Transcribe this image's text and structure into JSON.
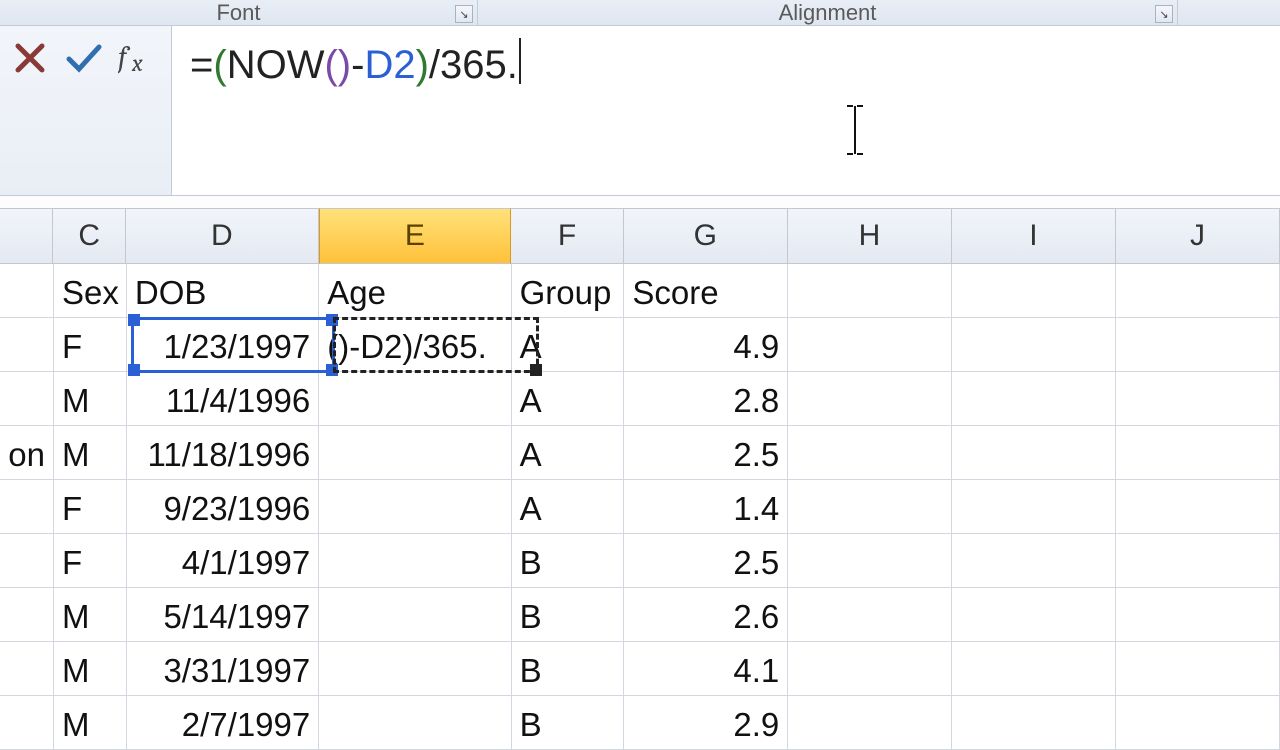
{
  "ribbon": {
    "font_label": "Font",
    "alignment_label": "Alignment"
  },
  "formula_bar": {
    "cancel_title": "Cancel",
    "enter_title": "Enter",
    "fx_title": "Insert Function",
    "formula_prefix": "=",
    "formula_open1": "(",
    "formula_fn": "NOW",
    "formula_open2": "(",
    "formula_close2": ")",
    "formula_minus": "-",
    "formula_ref": "D2",
    "formula_close1": ")",
    "formula_tail": "/365."
  },
  "columns": [
    "C",
    "D",
    "E",
    "F",
    "G",
    "H",
    "I",
    "J"
  ],
  "active_column": "E",
  "headers": {
    "b": "on",
    "c": "Sex",
    "d": "DOB",
    "e": "Age",
    "f": "Group",
    "g": "Score"
  },
  "editing_cell_display": "()-D2)/365.",
  "rows": [
    {
      "b": "",
      "c": "F",
      "d": "1/23/1997",
      "e": "",
      "f": "A",
      "g": "4.9"
    },
    {
      "b": "",
      "c": "M",
      "d": "11/4/1996",
      "e": "",
      "f": "A",
      "g": "2.8"
    },
    {
      "b": "on",
      "c": "M",
      "d": "11/18/1996",
      "e": "",
      "f": "A",
      "g": "2.5"
    },
    {
      "b": "",
      "c": "F",
      "d": "9/23/1996",
      "e": "",
      "f": "A",
      "g": "1.4"
    },
    {
      "b": "",
      "c": "F",
      "d": "4/1/1997",
      "e": "",
      "f": "B",
      "g": "2.5"
    },
    {
      "b": "",
      "c": "M",
      "d": "5/14/1997",
      "e": "",
      "f": "B",
      "g": "2.6"
    },
    {
      "b": "",
      "c": "M",
      "d": "3/31/1997",
      "e": "",
      "f": "B",
      "g": "4.1"
    },
    {
      "b": "",
      "c": "M",
      "d": "2/7/1997",
      "e": "",
      "f": "B",
      "g": "2.9"
    }
  ]
}
